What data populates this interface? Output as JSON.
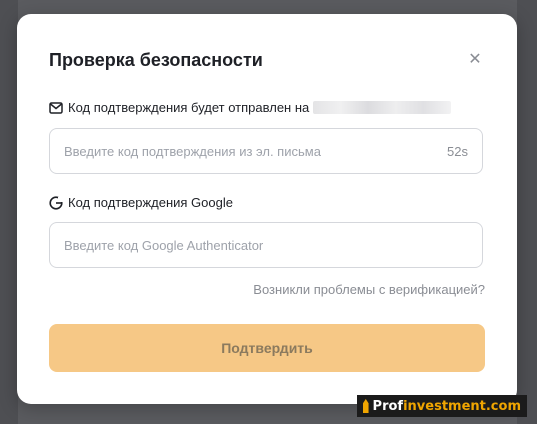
{
  "modal": {
    "title": "Проверка безопасности",
    "close_icon": "close-icon"
  },
  "email_section": {
    "icon": "mail-icon",
    "label": "Код подтверждения будет отправлен на",
    "input_placeholder": "Введите код подтверждения из эл. письма",
    "timer": "52s"
  },
  "google_section": {
    "icon": "google-icon",
    "label": "Код подтверждения Google",
    "input_placeholder": "Введите код Google Authenticator"
  },
  "problems_link": "Возникли проблемы с верификацией?",
  "confirm_button": "Подтвердить",
  "watermark": {
    "part1": "Prof",
    "part2": "investment.com"
  },
  "colors": {
    "accent_button": "#f6c886",
    "watermark_orange": "#f0a500"
  }
}
